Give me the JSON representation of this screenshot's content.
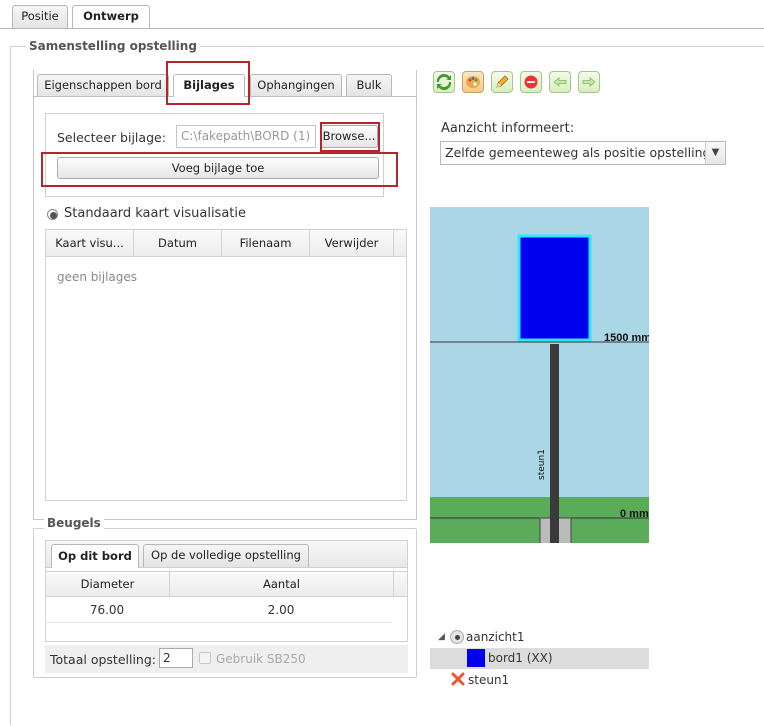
{
  "top_tabs": [
    {
      "label": "Positie",
      "active": false
    },
    {
      "label": "Ontwerp",
      "active": true
    }
  ],
  "composition": {
    "legend": "Samenstelling opstelling",
    "tabs": [
      {
        "label": "Eigenschappen bord",
        "active": false
      },
      {
        "label": "Bijlages",
        "active": true
      },
      {
        "label": "Ophangingen",
        "active": false
      },
      {
        "label": "Bulk",
        "active": false
      }
    ],
    "attachment": {
      "select_label": "Selecteer bijlage:",
      "file_value": "C:\\fakepath\\BORD (1)",
      "browse_label": "Browse...",
      "add_button_label": "Voeg bijlage toe"
    },
    "radio_label": "Standaard kaart visualisatie",
    "grid": {
      "columns": [
        "Kaart visu...",
        "Datum",
        "Filenaam",
        "Verwijder"
      ],
      "empty_text": "geen bijlages"
    }
  },
  "beugels": {
    "legend": "Beugels",
    "tabs": [
      {
        "label": "Op dit bord",
        "active": true
      },
      {
        "label": "Op de volledige opstelling",
        "active": false
      }
    ],
    "columns": [
      "Diameter",
      "Aantal"
    ],
    "rows": [
      {
        "diameter": "76.00",
        "aantal": "2.00"
      }
    ],
    "total_label": "Totaal opstelling:",
    "total_value": "2",
    "sb250_label": "Gebruik SB250"
  },
  "view": {
    "label": "Aanzicht informeert:",
    "selected_option": "Zelfde gemeenteweg als positie opstelling",
    "level_high": "1500 mm",
    "level_zero": "0 mm",
    "pole_label": "steun1"
  },
  "tree": {
    "root": "aanzicht1",
    "items": [
      {
        "label": "bord1 (XX)",
        "icon": "blue-square-icon"
      },
      {
        "label": "steun1",
        "icon": "red-x-icon"
      }
    ]
  },
  "colors": {
    "sky": "#abd6e6",
    "grass": "#5aac5a",
    "board": "#0000ee",
    "board_border": "#33e6ff",
    "pole": "#3a3a3a",
    "highlight": "#b3262b"
  }
}
